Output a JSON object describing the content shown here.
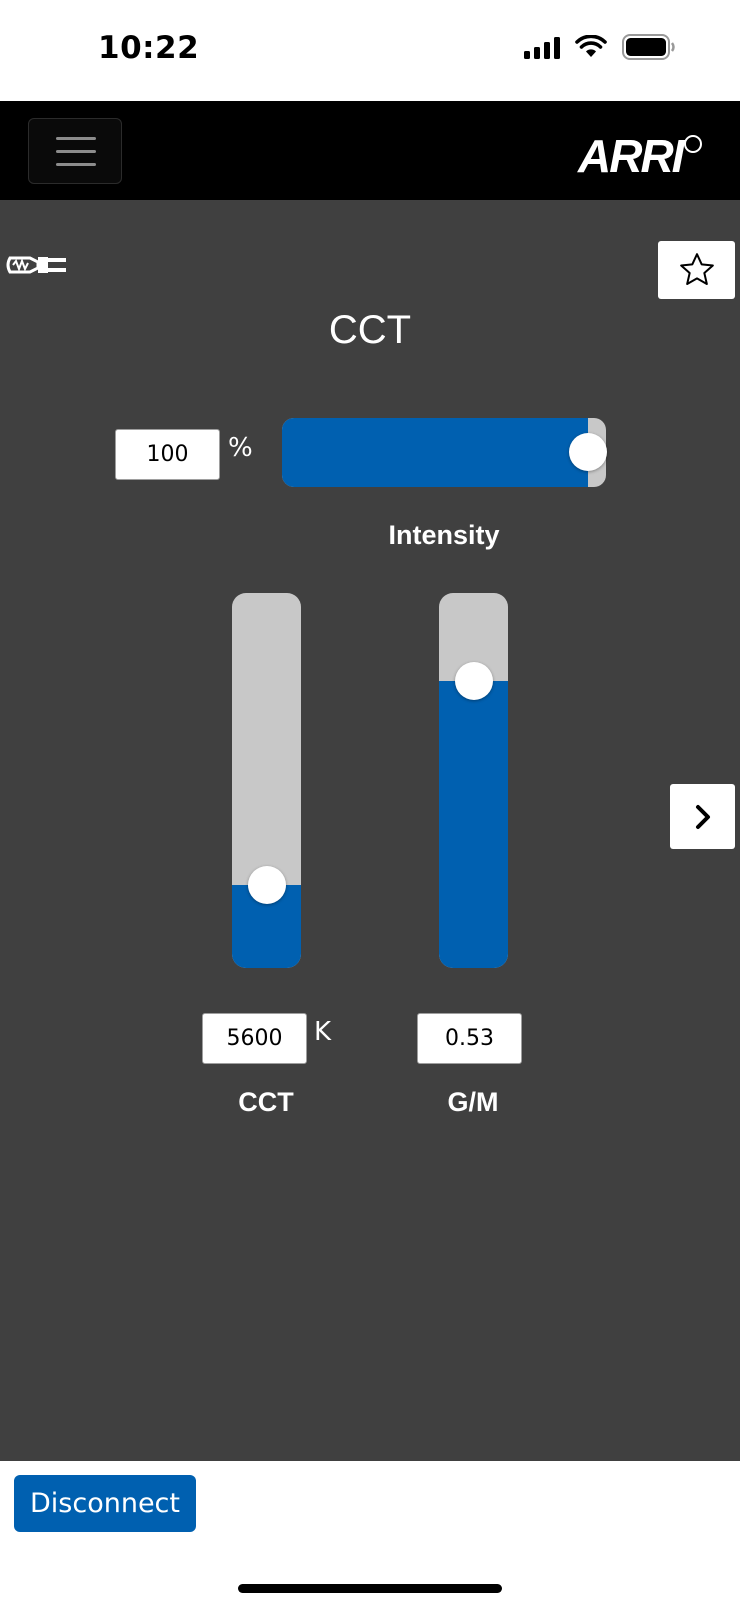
{
  "status_bar": {
    "time": "10:22",
    "signal_icon": "cellular-signal-icon",
    "wifi_icon": "wifi-icon",
    "battery_icon": "battery-icon"
  },
  "navbar": {
    "menu_icon": "hamburger-menu-icon",
    "logo_text": "ARRI"
  },
  "device": {
    "connection_icon": "plug-icon"
  },
  "actions": {
    "favorite_icon": "star-icon",
    "next_icon": "chevron-right-icon"
  },
  "mode": {
    "title": "CCT"
  },
  "intensity": {
    "value": "100",
    "unit": "%",
    "label": "Intensity",
    "fill_fraction": 1.0
  },
  "cct": {
    "value": "5600",
    "unit": "K",
    "label": "CCT",
    "fill_fraction": 0.22
  },
  "gm": {
    "value": "0.53",
    "label": "G/M",
    "fill_fraction": 0.765
  },
  "footer": {
    "disconnect_label": "Disconnect"
  },
  "colors": {
    "accent": "#0060b0",
    "background": "#404040",
    "track": "#c8c8c8"
  }
}
